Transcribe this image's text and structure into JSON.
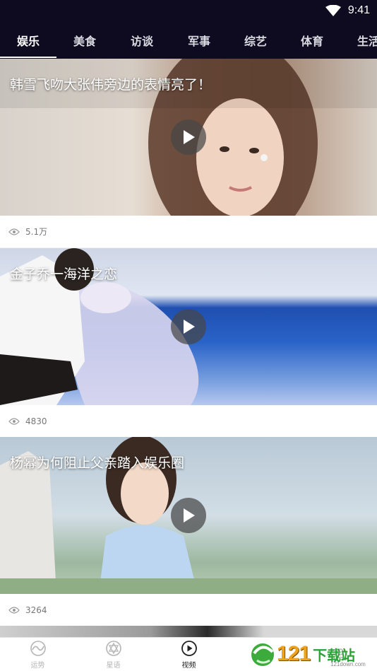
{
  "status_bar": {
    "time": "9:41"
  },
  "tabs": [
    {
      "label": "娱乐",
      "active": true
    },
    {
      "label": "美食",
      "active": false
    },
    {
      "label": "访谈",
      "active": false
    },
    {
      "label": "军事",
      "active": false
    },
    {
      "label": "综艺",
      "active": false
    },
    {
      "label": "体育",
      "active": false
    },
    {
      "label": "生活",
      "active": false
    }
  ],
  "videos": [
    {
      "title": "韩雪飞吻大张伟旁边的表情亮了！",
      "views": "5.1万"
    },
    {
      "title": "金子乔一海洋之恋",
      "views": "4830"
    },
    {
      "title": "杨幂为何阻止父亲踏入娱乐圈",
      "views": "3264"
    }
  ],
  "bottom_nav": [
    {
      "label": "运势",
      "icon": "fortune-icon",
      "active": false
    },
    {
      "label": "星语",
      "icon": "star-icon",
      "active": false
    },
    {
      "label": "视频",
      "icon": "play-circle-icon",
      "active": true
    }
  ],
  "watermark": {
    "logo": "121",
    "text": "下载站",
    "sub": "121down.com"
  },
  "colors": {
    "header_bg": "#0e0b21",
    "active_nav": "#222222",
    "inactive_nav": "#b5b5b5"
  }
}
